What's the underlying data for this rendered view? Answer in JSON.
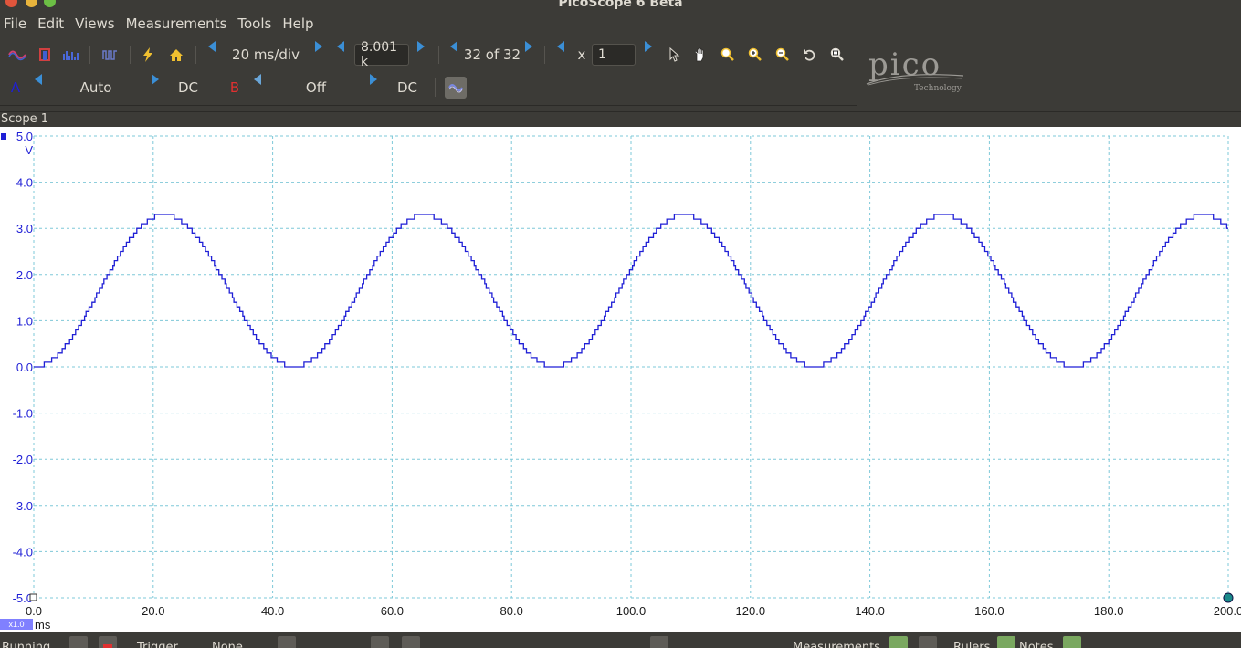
{
  "window": {
    "title": "PicoScope 6 Beta"
  },
  "menu": [
    "File",
    "Edit",
    "Views",
    "Measurements",
    "Tools",
    "Help"
  ],
  "toolbar": {
    "timebase": "20 ms/div",
    "samples": "8.001 k",
    "buffer": "32 of 32",
    "zoom_prefix": "x",
    "zoom_value": "1"
  },
  "channels": {
    "a": {
      "label": "A",
      "range": "Auto",
      "coupling": "DC",
      "color": "#1f1fd6"
    },
    "b": {
      "label": "B",
      "range": "Off",
      "coupling": "DC",
      "color": "#e03030"
    }
  },
  "logo": {
    "word": "pico",
    "sub": "Technology"
  },
  "scope": {
    "title": "Scope 1"
  },
  "plot": {
    "y_unit": "V",
    "x_unit": "ms",
    "x_zoom_badge": "x1.0",
    "y_ticks": [
      "5.0",
      "4.0",
      "3.0",
      "2.0",
      "1.0",
      "0.0",
      "-1.0",
      "-2.0",
      "-3.0",
      "-4.0",
      "-5.0"
    ],
    "x_ticks": [
      "0.0",
      "20.0",
      "40.0",
      "60.0",
      "80.0",
      "100.0",
      "120.0",
      "140.0",
      "160.0",
      "180.0",
      "200.0"
    ]
  },
  "chart_data": {
    "type": "line",
    "xlim": [
      0,
      200
    ],
    "ylim": [
      -5,
      5
    ],
    "grid": true,
    "series": [
      {
        "color": "#1f1fd6",
        "waveform": "sine",
        "offset_v": 1.65,
        "amplitude_v": 1.65,
        "period_ms": 43.5,
        "start_phase": "minimum at t=0",
        "step_v": 0.1
      }
    ]
  },
  "status": {
    "run_state": "Running",
    "trigger_label": "Trigger",
    "trigger_mode": "None",
    "measurements_label": "Measurements",
    "rulers_label": "Rulers",
    "notes_label": "Notes"
  },
  "colors": {
    "chrome": "#3c3b37",
    "accent_arrow": "#3b8fd6",
    "grid": "#7ec8d8",
    "axis_text": "#1f1fd6"
  }
}
